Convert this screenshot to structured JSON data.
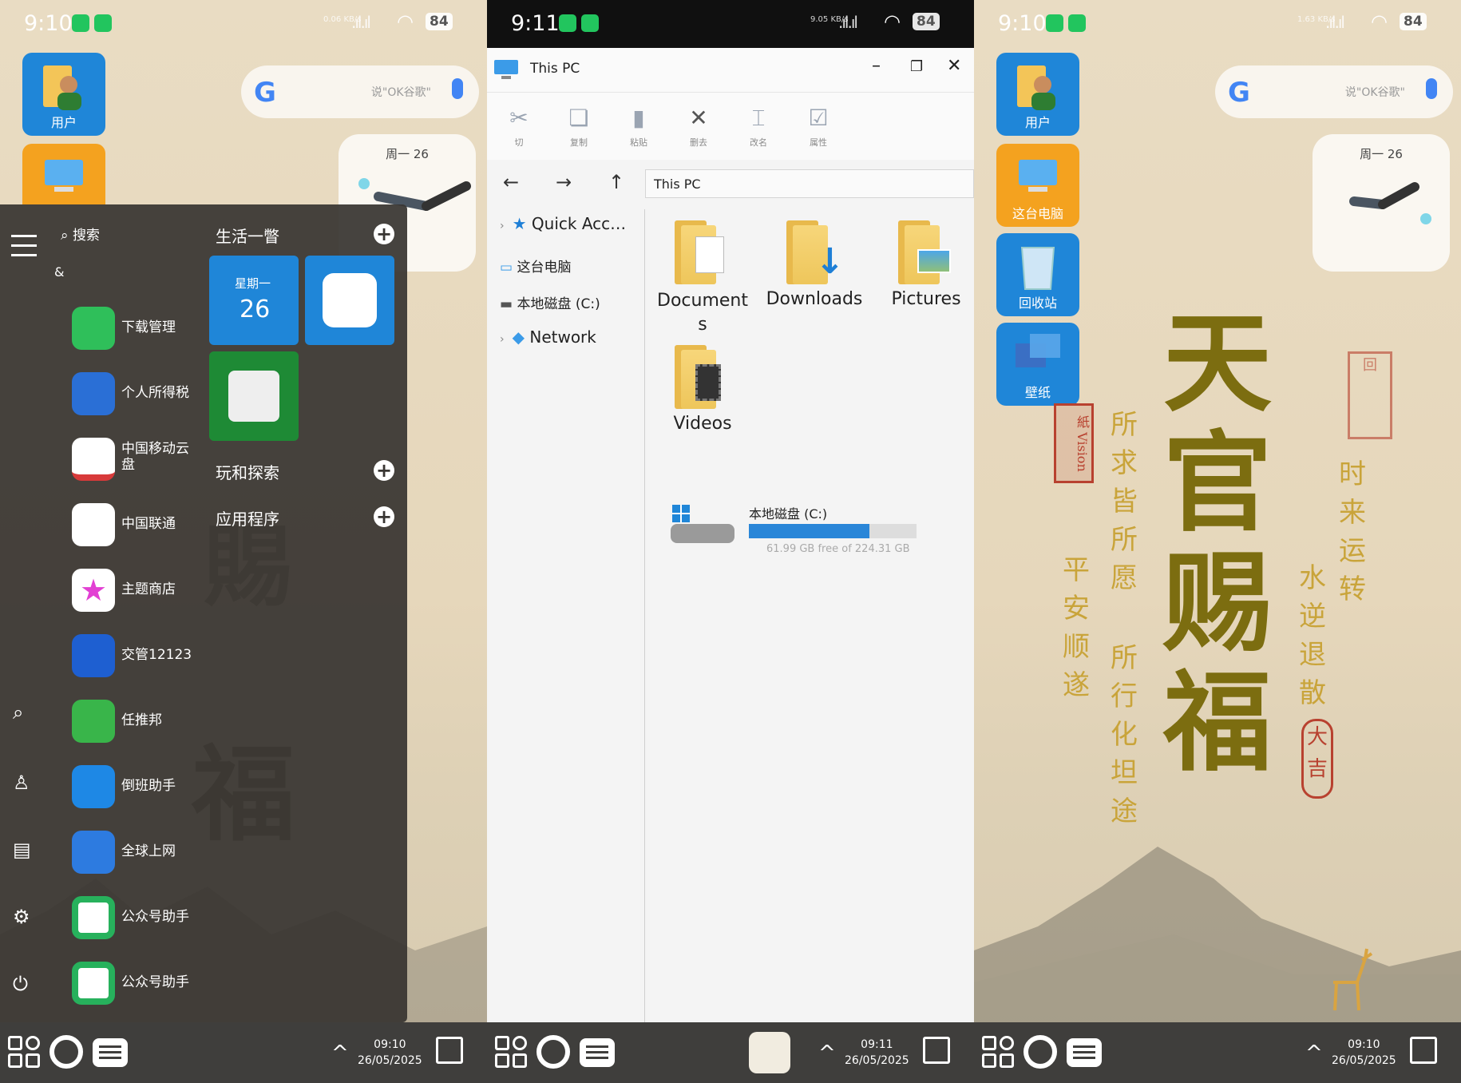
{
  "left": {
    "status": {
      "time": "9:10",
      "net_speed": "0.06 KB/s",
      "battery": "84"
    },
    "desktop_icons": [
      {
        "label": "用户"
      },
      {
        "label": "这台电脑"
      }
    ],
    "search_hint": "说\"OK谷歌\"",
    "clock_widget_date": "周一 26",
    "start_menu": {
      "search_label": "搜索",
      "letter": "&",
      "apps": [
        {
          "name": "下载管理",
          "color": "#2fbf5a"
        },
        {
          "name": "个人所得税",
          "color": "#2a6fd6"
        },
        {
          "name": "中国移动云盘",
          "color": "#ffffff"
        },
        {
          "name": "中国联通",
          "color": "#ffffff"
        },
        {
          "name": "主题商店",
          "color": "#ffffff"
        },
        {
          "name": "交管12123",
          "color": "#1e5fd1"
        },
        {
          "name": "任推邦",
          "color": "#39b54a"
        },
        {
          "name": "倒班助手",
          "color": "#1e88e5"
        },
        {
          "name": "全球上网",
          "color": "#2d7be0"
        },
        {
          "name": "公众号助手",
          "color": "#ffffff"
        },
        {
          "name": "公众号助手",
          "color": "#ffffff"
        }
      ],
      "sections": [
        {
          "title": "生活一瞥"
        },
        {
          "title": "玩和探索"
        },
        {
          "title": "应用程序"
        }
      ],
      "calendar_tile": {
        "weekday": "星期一",
        "day": "26"
      }
    },
    "taskbar": {
      "time": "09:10",
      "date": "26/05/2025"
    }
  },
  "middle": {
    "status": {
      "time": "9:11",
      "net_speed": "9.05 KB/s",
      "battery": "84"
    },
    "window_title": "This PC",
    "ribbon": [
      {
        "label": "切",
        "icon": "scissors-icon"
      },
      {
        "label": "复制",
        "icon": "copy-icon"
      },
      {
        "label": "粘贴",
        "icon": "paste-icon"
      },
      {
        "label": "删去",
        "icon": "delete-icon"
      },
      {
        "label": "改名",
        "icon": "rename-icon"
      },
      {
        "label": "属性",
        "icon": "properties-icon"
      }
    ],
    "address": "This PC",
    "nav_items": [
      {
        "label": "Quick Acc…"
      },
      {
        "label": "这台电脑"
      },
      {
        "label": "本地磁盘 (C:)"
      },
      {
        "label": "Network"
      }
    ],
    "folders": [
      {
        "name": "Document s"
      },
      {
        "name": "Downloads"
      },
      {
        "name": "Pictures"
      },
      {
        "name": "Videos"
      }
    ],
    "drive": {
      "name": "本地磁盘 (C:)",
      "free_text": "61.99 GB free of 224.31 GB",
      "used_fraction": 0.72
    },
    "taskbar": {
      "time": "09:11",
      "date": "26/05/2025"
    }
  },
  "right": {
    "status": {
      "time": "9:10",
      "net_speed": "1.63 KB/s",
      "battery": "84"
    },
    "desktop_icons": [
      {
        "label": "用户"
      },
      {
        "label": "这台电脑"
      },
      {
        "label": "回收站"
      },
      {
        "label": "壁纸"
      }
    ],
    "search_hint": "说\"OK谷歌\"",
    "clock_widget_date": "周一 26",
    "wallpaper": {
      "main": "天官赐福",
      "col1": "平安顺遂",
      "col2a": "所求皆所愿",
      "col2b": "所行化坦途",
      "col3": "时来运转",
      "col4": "水逆退散",
      "seal_small": "大吉"
    },
    "taskbar": {
      "time": "09:10",
      "date": "26/05/2025"
    }
  }
}
